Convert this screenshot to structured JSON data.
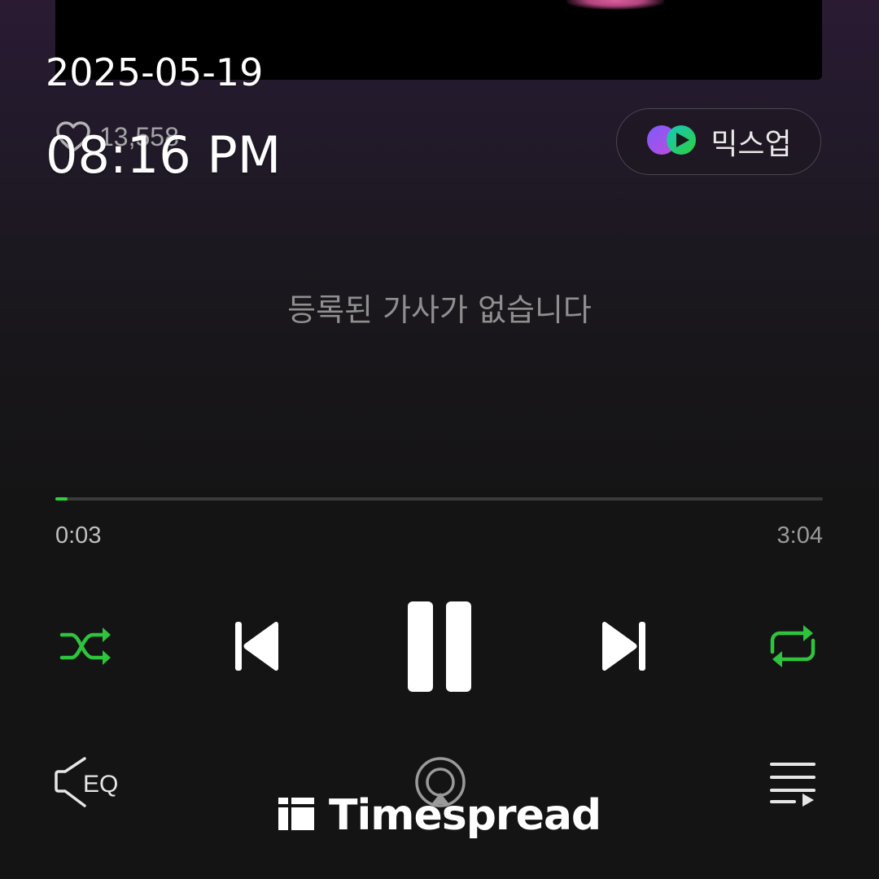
{
  "overlay": {
    "date": "2025-05-19",
    "time": "08:16 PM"
  },
  "track": {
    "like_count": "13,558",
    "lyrics_empty_message": "등록된 가사가 없습니다",
    "elapsed": "0:03",
    "duration": "3:04",
    "progress_fraction": 0.016
  },
  "buttons": {
    "mixup_label": "믹스업"
  },
  "icons": {
    "like": "heart-icon",
    "mixup": "mixup-logo-icon",
    "shuffle": "shuffle-icon",
    "previous": "skip-previous-icon",
    "pause": "pause-icon",
    "next": "skip-next-icon",
    "repeat": "repeat-icon",
    "eq": "eq-icon",
    "cast": "airplay-icon",
    "playlist": "playlist-icon"
  },
  "colors": {
    "accent": "#2ed03c",
    "background": "#141414",
    "text_muted": "#8f8f8f"
  },
  "watermark": {
    "text": "Timespread"
  }
}
